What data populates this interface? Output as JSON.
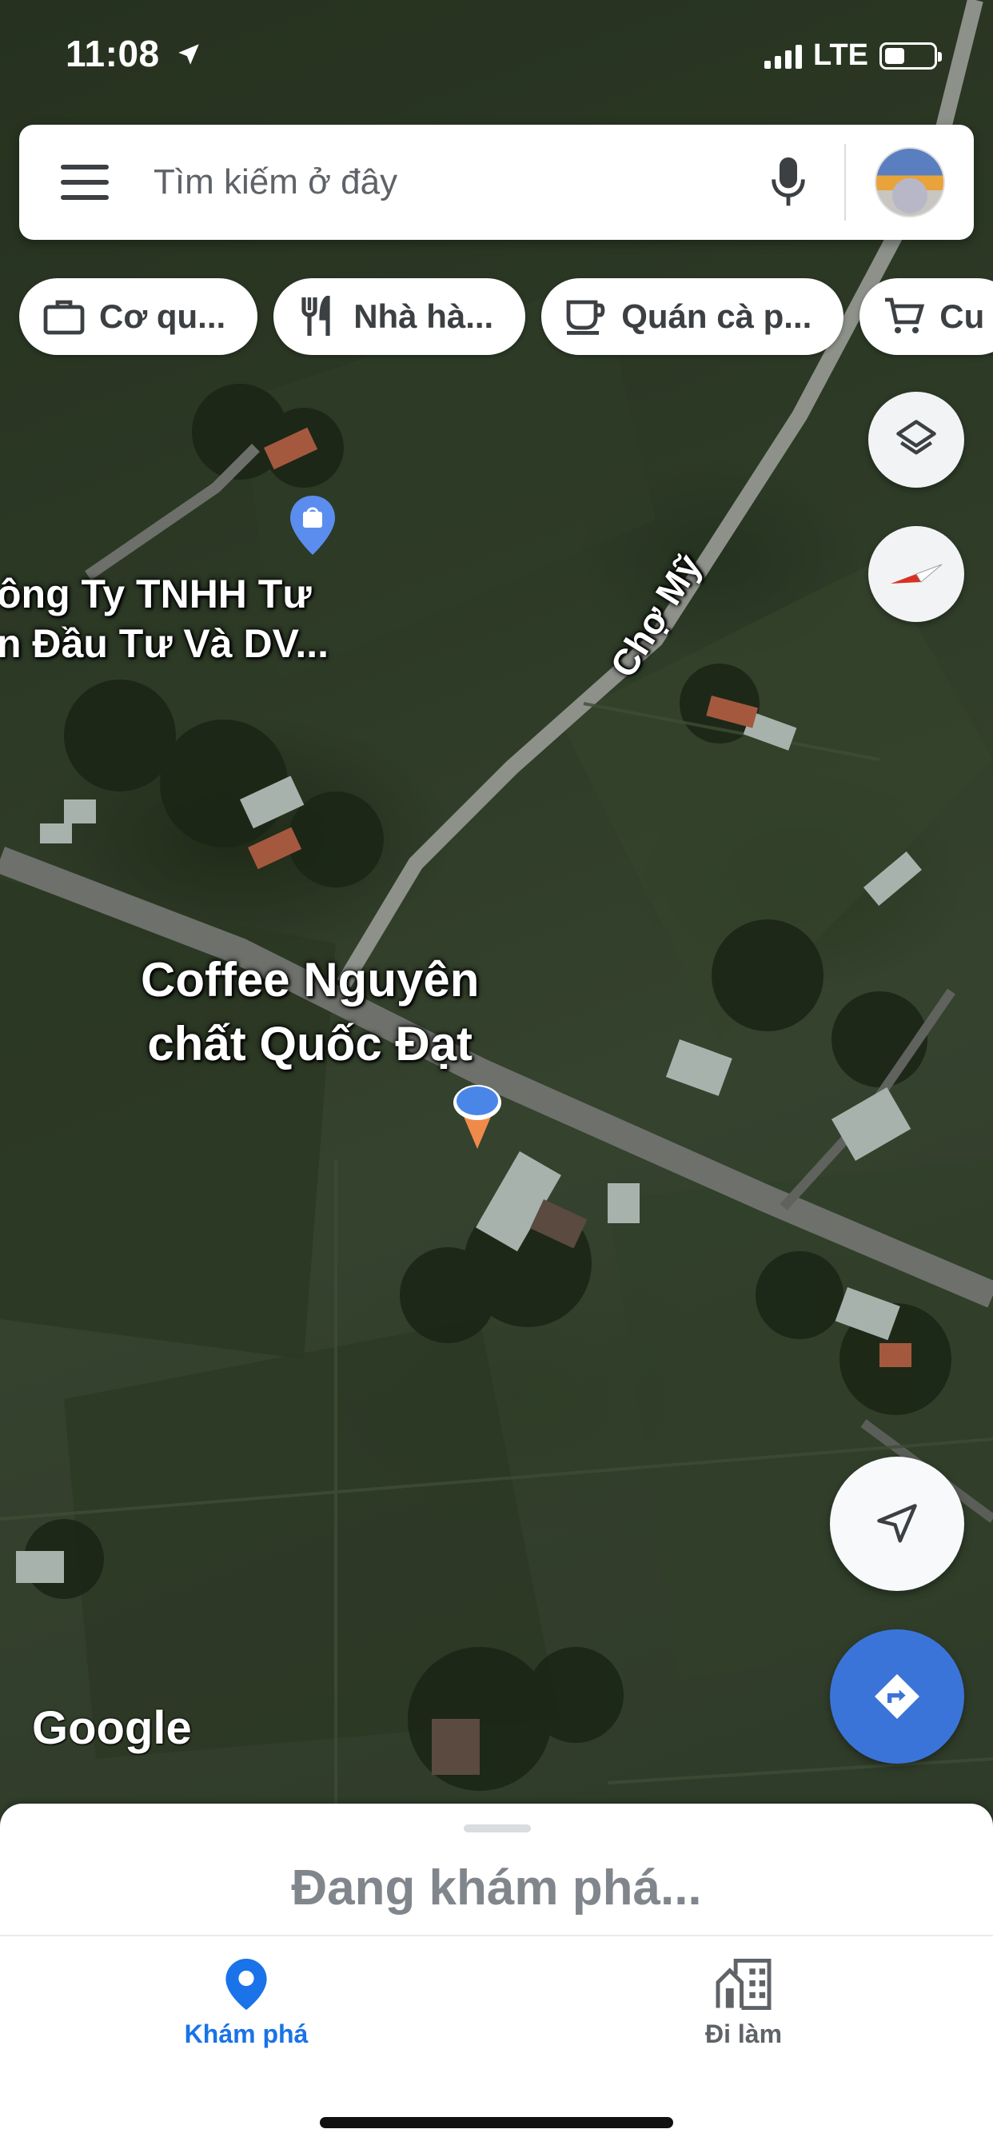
{
  "status_bar": {
    "time": "11:08",
    "network": "LTE"
  },
  "search": {
    "placeholder": "Tìm kiếm ở đây"
  },
  "chips": [
    {
      "label": "Cơ qu...",
      "icon": "briefcase-icon"
    },
    {
      "label": "Nhà hà...",
      "icon": "fork-knife-icon"
    },
    {
      "label": "Quán cà p...",
      "icon": "coffee-cup-icon"
    },
    {
      "label": "Cu",
      "icon": "shopping-cart-icon"
    }
  ],
  "map": {
    "road_label": "Chợ Mỹ",
    "place_label_line1": "ông Ty TNHH Tư",
    "place_label_line2": "n Đầu Tư Và DV...",
    "coffee_label_line1": "Coffee Nguyên",
    "coffee_label_line2": "chất Quốc Đạt",
    "attribution": "Google"
  },
  "bottom_sheet": {
    "title": "Đang khám phá..."
  },
  "tabs": [
    {
      "label": "Khám phá",
      "icon": "location-pin-icon",
      "active": true
    },
    {
      "label": "Đi làm",
      "icon": "office-building-icon",
      "active": false
    }
  ],
  "colors": {
    "accent_blue": "#1a73e8",
    "directions_fab": "#3b74d9",
    "place_pin_blue": "#5b8def"
  }
}
